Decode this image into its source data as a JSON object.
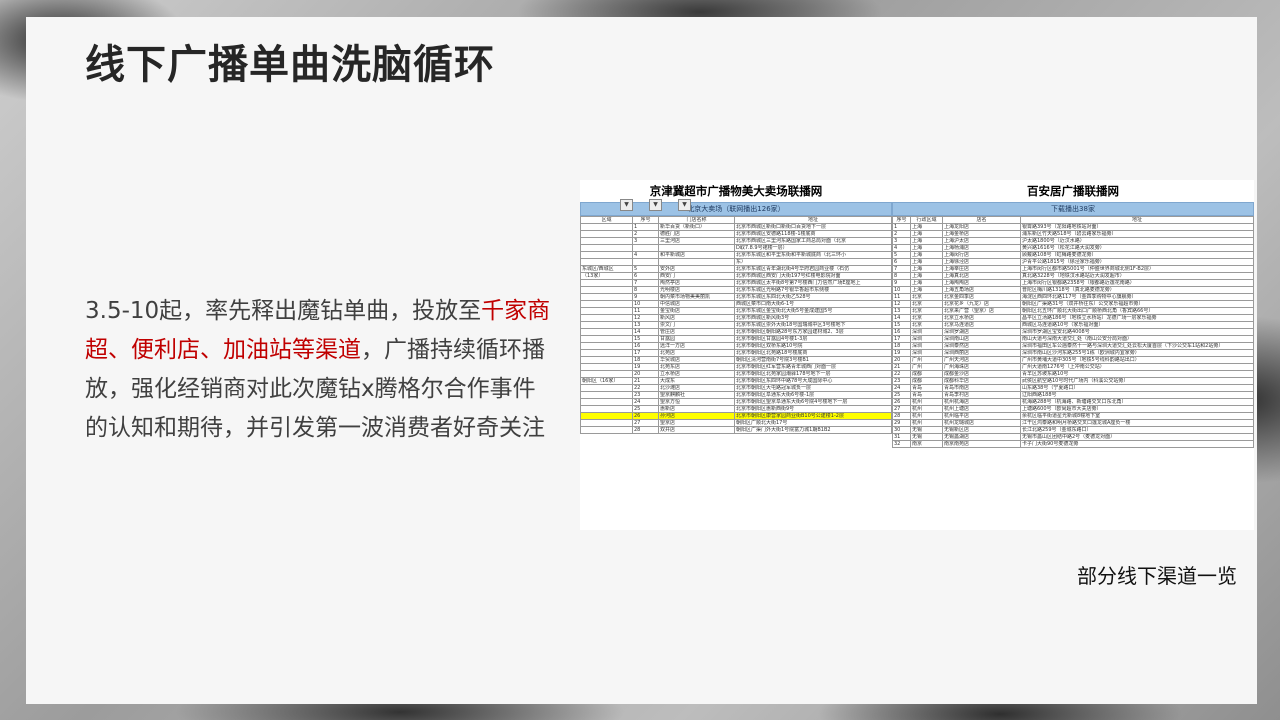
{
  "title": "线下广播单曲洗脑循环",
  "body": {
    "seg1": "3.5-10起，率先释出魔钻单曲，投放至",
    "seg2": "千家商超、便利店、加油站等渠道",
    "seg3": "，广播持续循环播放，强化经销商对此次魔钻x腾格尔合作事件的认知和期待，并引发第一波消费者好奇关注"
  },
  "caption": "部分线下渠道一览",
  "colors": {
    "highlight": "#c00000",
    "title": "#262626",
    "header_blue": "#9cc2e5"
  },
  "left_table": {
    "title": "京津冀超市广播物美大卖场联播网",
    "subtitle": "北京大卖场（联网播出126家）",
    "headers": [
      "区域",
      "序号",
      "门店名称",
      "地址"
    ],
    "rows": [
      {
        "region": "",
        "no": "1",
        "store": "新华百货（新街口）",
        "addr": "北京市西城区新街口新街口百货地下一层"
      },
      {
        "region": "",
        "no": "2",
        "store": "德胜门店",
        "addr": "北京市西城区安德路118楼-1楼底商"
      },
      {
        "region": "",
        "no": "3",
        "store": "三里河店",
        "addr": "北京市西城区三里河东路国家工商总局对面（北京"
      },
      {
        "region": "",
        "no": "",
        "store": "",
        "addr": "D取7.8.9号裙楼一层）"
      },
      {
        "region": "",
        "no": "4",
        "store": "和平新城店",
        "addr": "北京市东城区和平里东街和平新城底商（北三环小"
      },
      {
        "region": "",
        "no": "",
        "store": "",
        "addr": "东）"
      },
      {
        "region": "东城区/西城区",
        "no": "5",
        "store": "安外店",
        "addr": "北京市东城区青年湖北街4号华府君园商业楼（石仿"
      },
      {
        "region": "（13家）",
        "no": "6",
        "store": "西安门",
        "addr": "北京市西城区西安门大街197号红楼电影院对面"
      },
      {
        "region": "",
        "no": "7",
        "store": "陶然亭店",
        "addr": "北京市西城区太平街8号第7号楼西门力信然广场E座地上"
      },
      {
        "region": "",
        "no": "8",
        "store": "光明楼店",
        "addr": "北京市东城区光明路7号银华香超市东侧楼"
      },
      {
        "region": "",
        "no": "9",
        "store": "朝内菜市场物美美丽凯",
        "addr": "北京市东城区东四北大街乙528号"
      },
      {
        "region": "",
        "no": "10",
        "store": "中信城店",
        "addr": "西城区菜市口南大街6-1号"
      },
      {
        "region": "",
        "no": "11",
        "store": "金宝街店",
        "addr": "北京市东城区金宝街北大街5号金成建国5号"
      },
      {
        "region": "",
        "no": "12",
        "store": "新风店",
        "addr": "北京市西城区新风街3号"
      },
      {
        "region": "",
        "no": "13",
        "store": "崇文门",
        "addr": "北京市东城区崇外大街18号国瑞城中区3号楼地下"
      },
      {
        "region": "",
        "no": "14",
        "store": "管庄店",
        "addr": "北京市朝阳区朝阳路28号东方家园建材城2、3层"
      },
      {
        "region": "",
        "no": "15",
        "store": "甘露园",
        "addr": "北京市朝阳区甘露园4号楼1-3层"
      },
      {
        "region": "",
        "no": "16",
        "store": "远洋一方店",
        "addr": "北京市朝阳区双桥东路10号院"
      },
      {
        "region": "",
        "no": "17",
        "store": "北苑店",
        "addr": "北京市朝阳区北苑路18号楼底商"
      },
      {
        "region": "",
        "no": "18",
        "store": "华贸城店",
        "addr": "朝阳区清河营南街7号院3号楼B1"
      },
      {
        "region": "",
        "no": "19",
        "store": "北苑东店",
        "addr": "北京市朝阳区红军营东路青年城西门对面一层"
      },
      {
        "region": "",
        "no": "20",
        "store": "立水桥店",
        "addr": "北京市朝阳区北苑家园潮驿178号地下一层"
      },
      {
        "region": "朝阳区（16家）",
        "no": "21",
        "store": "大成东",
        "addr": "北京市朝阳区东四环中路78号大成国际中心"
      },
      {
        "region": "",
        "no": "22",
        "store": "北沙滩店",
        "addr": "北京市朝阳区大屯路冠军城负一层"
      },
      {
        "region": "",
        "no": "23",
        "store": "望京麒麟社",
        "addr": "北京市朝阳区阜通东大街6号楼-1层"
      },
      {
        "region": "",
        "no": "24",
        "store": "望京方恒",
        "addr": "北京市朝阳区望京阜通东大街6号院4号楼地下一层"
      },
      {
        "region": "",
        "no": "25",
        "store": "惠新店",
        "addr": "北京市朝阳区惠新西街9号"
      },
      {
        "region": "",
        "no": "26",
        "store": "孙河店",
        "addr": "北京市朝阳区康营家园商业街B10号公建楼1-2层"
      },
      {
        "region": "",
        "no": "27",
        "store": "望京店",
        "addr": "朝阳区广顺北大街17号"
      },
      {
        "region": "",
        "no": "28",
        "store": "双井店",
        "addr": "朝阳区广渠门外大街1号院富力城1期B1B2"
      }
    ]
  },
  "right_table": {
    "title": "百安居广播联播网",
    "subtitle": "下载播出38家",
    "headers": [
      "序号",
      "行政区域",
      "店名",
      "地址"
    ],
    "rows": [
      [
        "1",
        "上海",
        "上海龙阳店",
        "银霄路393号（龙阳路地铁站对面）"
      ],
      [
        "2",
        "上海",
        "上海金桥店",
        "浦东新区竹天路518号（碧云路家乐福旁）"
      ],
      [
        "3",
        "上海",
        "上海沪太店",
        "沪太路1800号（近汶水路）"
      ],
      [
        "4",
        "上海",
        "上海杨浦店",
        "黄兴路1616号（松花江路大润发旁）"
      ],
      [
        "5",
        "上海",
        "上海闵行店",
        "顾戴路108号（虹梅路麦德龙旁）"
      ],
      [
        "6",
        "上海",
        "上海徐泾店",
        "沪青平公路1815号（徐泾家乐福旁）"
      ],
      [
        "7",
        "上海",
        "上海莘庄店",
        "上海市闵行区都市路5001号（仲盛世界商城北侧1F-B2层）"
      ],
      [
        "8",
        "上海",
        "上海真北店",
        "真北路3228号（地铁汉水路站近大润发超市）"
      ],
      [
        "9",
        "上海",
        "上海陶陶店",
        "上海市闵行区银都路2358号（银都路近莲花南路）"
      ],
      [
        "10",
        "上海",
        "上海五角场店",
        "普陀区梅川路1318号（真北路麦德龙旁）"
      ],
      [
        "11",
        "北京",
        "北京金四季店",
        "海淀区西四环北路117号（金四季购物中心旗舰旁）"
      ],
      [
        "12",
        "北京",
        "北京花乡（九龙）店",
        "朝阳区广渠路31号（双井桥往东）公交家乐福超市旁）"
      ],
      [
        "13",
        "北京",
        "北京来广营（望京）店",
        "朝阳区北五环广顺北大街出口广顺桥西北角（香宾路66号）"
      ],
      [
        "14",
        "北京",
        "北京立水桥店",
        "昌平区立汤路186号（地铁立水桥站）龙德广场一层家乐福旁"
      ],
      [
        "15",
        "北京",
        "北京马连道店",
        "西城区马连道路10号（家乐福对面）"
      ],
      [
        "16",
        "深圳",
        "深圳罗湖店",
        "深圳市罗湖区宝安北路4008号"
      ],
      [
        "17",
        "深圳",
        "深圳南山店",
        "南山大道与深南大道交汇处（南山公安分局对面）"
      ],
      [
        "18",
        "深圳",
        "深圳泰然店",
        "深圳市福田区车公庙泰然十一路与深圳大道交汇处云松大厦首层（下沙公交车1站和2站旁）"
      ],
      [
        "19",
        "深圳",
        "深圳西丽店",
        "深圳市南山区沙河东路255号1栋（欧洲城内宜家旁）"
      ],
      [
        "20",
        "广州",
        "广州天河店",
        "广州市黄埔大道中305号（地铁5号线科韵路站出口）"
      ],
      [
        "21",
        "广州",
        "广州海珠店",
        "广州大道南1276号（上冲南公交站）"
      ],
      [
        "22",
        "成都",
        "成都金沙店",
        "青羊区苏坡东路10号"
      ],
      [
        "23",
        "成都",
        "成都科华店",
        "武侯区航空路10号时代广场内（科溪公交站旁）"
      ],
      [
        "24",
        "青岛",
        "青岛市南店",
        "山东路38号（宁夏路口）"
      ],
      [
        "25",
        "青岛",
        "青岛李村店",
        "辽阳西路188号"
      ],
      [
        "26",
        "杭州",
        "杭州杭海店",
        "杭海路288号（杭海路、新塘路交叉口东北角）"
      ],
      [
        "27",
        "杭州",
        "杭州上塘店",
        "上塘路600号（欧尚超市大关店旁）"
      ],
      [
        "28",
        "杭州",
        "杭州临平店",
        "余杭区临平街道星光新城8幢地下室"
      ],
      [
        "29",
        "杭州",
        "杭州龙璐城店",
        "江干区鸿泰路和明月桥路交叉口莲龙城A座负一楼"
      ],
      [
        "30",
        "无锡",
        "无锡新区店",
        "长江北路259号（金城东路口）"
      ],
      [
        "31",
        "无锡",
        "无锡蠡湖店",
        "无锡市蠡山区团结中路2号（麦德龙对面）"
      ],
      [
        "32",
        "南京",
        "南京南苑店",
        "卡子门大街90号麦德龙旁"
      ]
    ]
  }
}
